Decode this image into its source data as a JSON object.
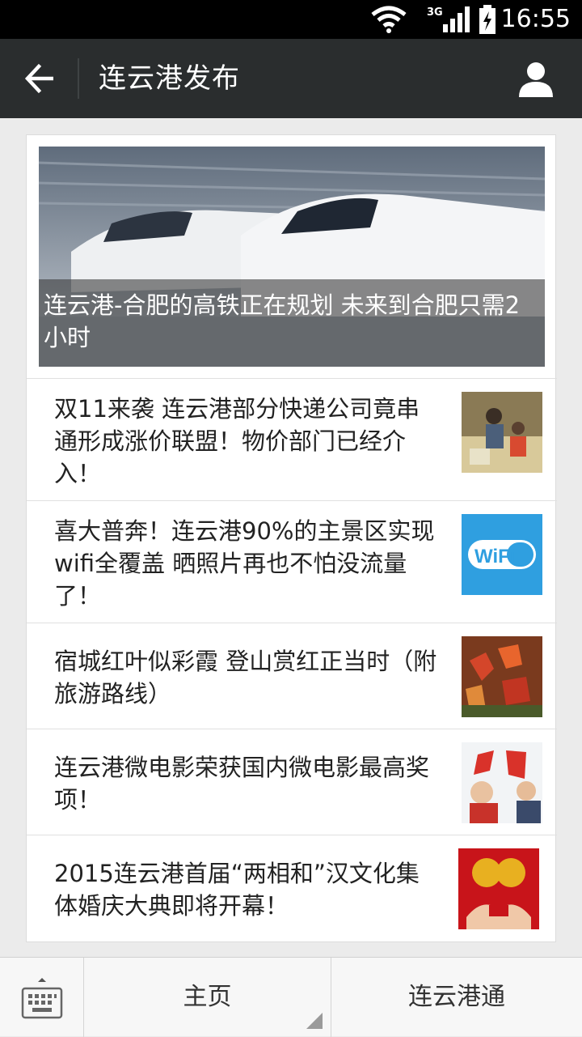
{
  "status": {
    "time": "16:55",
    "network": "3G"
  },
  "nav": {
    "title": "连云港发布"
  },
  "hero": {
    "caption": "连云港-合肥的高铁正在规划  未来到合肥只需2小时"
  },
  "articles": [
    {
      "title": "双11来袭  连云港部分快递公司竟串通形成涨价联盟！物价部门已经介入！",
      "thumb": "delivery-photo"
    },
    {
      "title": "喜大普奔！连云港90%的主景区实现wifi全覆盖  晒照片再也不怕没流量了！",
      "thumb": "wifi-logo",
      "thumb_text": "WiFi"
    },
    {
      "title": "宿城红叶似彩霞 登山赏红正当时（附旅游路线）",
      "thumb": "red-leaves-photo"
    },
    {
      "title": "连云港微电影荣获国内微电影最高奖项！",
      "thumb": "film-poster"
    },
    {
      "title": "2015连云港首届“两相和”汉文化集体婚庆大典即将开幕！",
      "thumb": "wedding-photo"
    }
  ],
  "bottom": {
    "home_label": "主页",
    "lyg_label": "连云港通"
  },
  "colors": {
    "nav_bg": "#2a2d2e",
    "page_bg": "#ebebeb",
    "wifi_blue": "#2f9fe0"
  }
}
